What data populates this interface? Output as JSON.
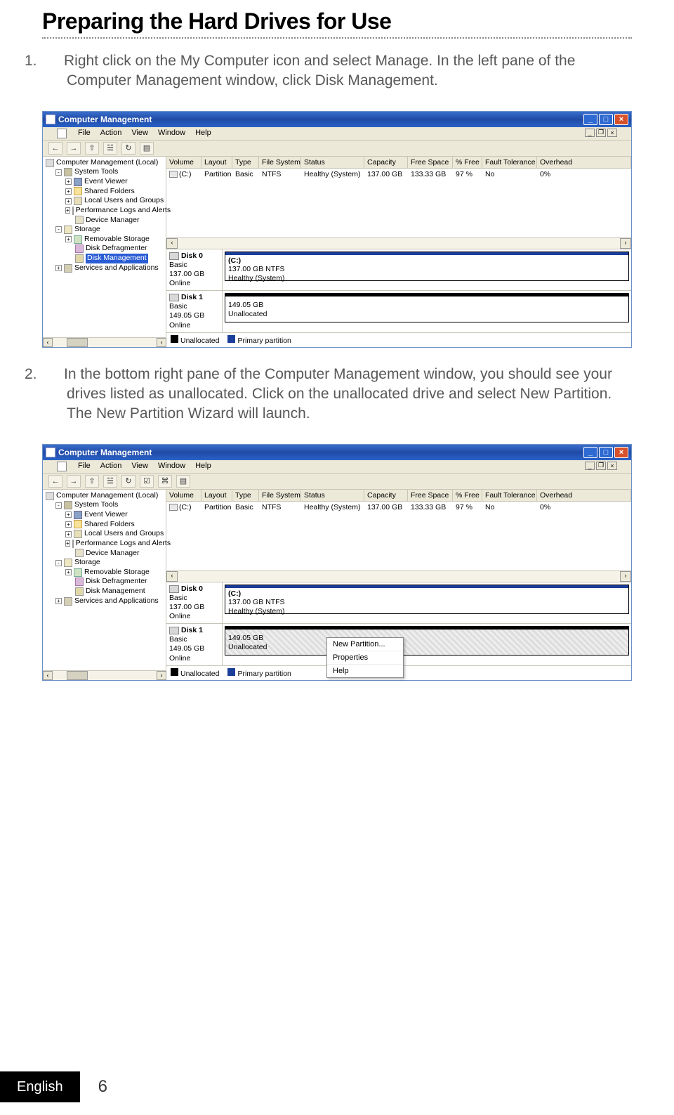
{
  "page": {
    "title": "Preparing the Hard Drives for Use",
    "step1_num": "1.",
    "step1": "Right click on the My Computer icon and select Manage. In the left pane of the Computer Management window, click Disk Management.",
    "step2_num": "2.",
    "step2": "In the bottom right pane of the Computer Management window, you should see your drives listed as unallocated. Click on the unallocated drive and select New Partition. The New Partition Wizard will launch."
  },
  "footer": {
    "lang": "English",
    "page": "6"
  },
  "window": {
    "title": "Computer Management",
    "title_icon_name": "computer-management-icon",
    "controls": {
      "min": "_",
      "max": "□",
      "close": "×"
    },
    "menu": {
      "file": "File",
      "action": "Action",
      "view": "View",
      "window": "Window",
      "help": "Help"
    },
    "childctl": {
      "min": "_",
      "restore": "❐",
      "close": "×"
    },
    "toolbar": {
      "back": "←",
      "fwd": "→",
      "up": "⇧",
      "props": "☱",
      "refresh": "↻",
      "extra1": "☑",
      "extra2": "⌘",
      "extra3": "▤"
    }
  },
  "tree": {
    "root": "Computer Management (Local)",
    "systools": "System Tools",
    "eventviewer": "Event Viewer",
    "sharedfolders": "Shared Folders",
    "localusers": "Local Users and Groups",
    "perf": "Performance Logs and Alerts",
    "device": "Device Manager",
    "storage": "Storage",
    "removable": "Removable Storage",
    "defrag": "Disk Defragmenter",
    "diskmgmt": "Disk Management",
    "services": "Services and Applications"
  },
  "volumes": {
    "headers": {
      "vol": "Volume",
      "layout": "Layout",
      "type": "Type",
      "fs": "File System",
      "status": "Status",
      "cap": "Capacity",
      "free": "Free Space",
      "pctfree": "% Free",
      "fault": "Fault Tolerance",
      "overhead": "Overhead"
    },
    "row0": {
      "vol": "(C:)",
      "layout": "Partition",
      "type": "Basic",
      "fs": "NTFS",
      "status": "Healthy (System)",
      "cap": "137.00 GB",
      "free": "133.33 GB",
      "pctfree": "97 %",
      "fault": "No",
      "overhead": "0%"
    }
  },
  "disks": {
    "d0": {
      "name": "Disk 0",
      "type": "Basic",
      "size": "137.00 GB",
      "status": "Online",
      "part_label": "(C:)",
      "part_size": "137.00 GB NTFS",
      "part_status": "Healthy (System)"
    },
    "d1_a": {
      "name": "Disk 1",
      "type": "Basic",
      "size": "149.05 GB",
      "status": "Online",
      "unalloc_size": "149.05 GB",
      "unalloc_label": "Unallocated"
    },
    "d1_b": {
      "name": "Disk 1",
      "type": "Basic",
      "size": "149.05 GB",
      "status": "Online",
      "unalloc_size": "149.05 GB",
      "unalloc_label": "Unallocated"
    }
  },
  "legend": {
    "unalloc": "Unallocated",
    "primary": "Primary partition"
  },
  "context_menu": {
    "new_partition": "New Partition...",
    "properties": "Properties",
    "help": "Help"
  },
  "scroll": {
    "left": "‹",
    "right": "›"
  }
}
